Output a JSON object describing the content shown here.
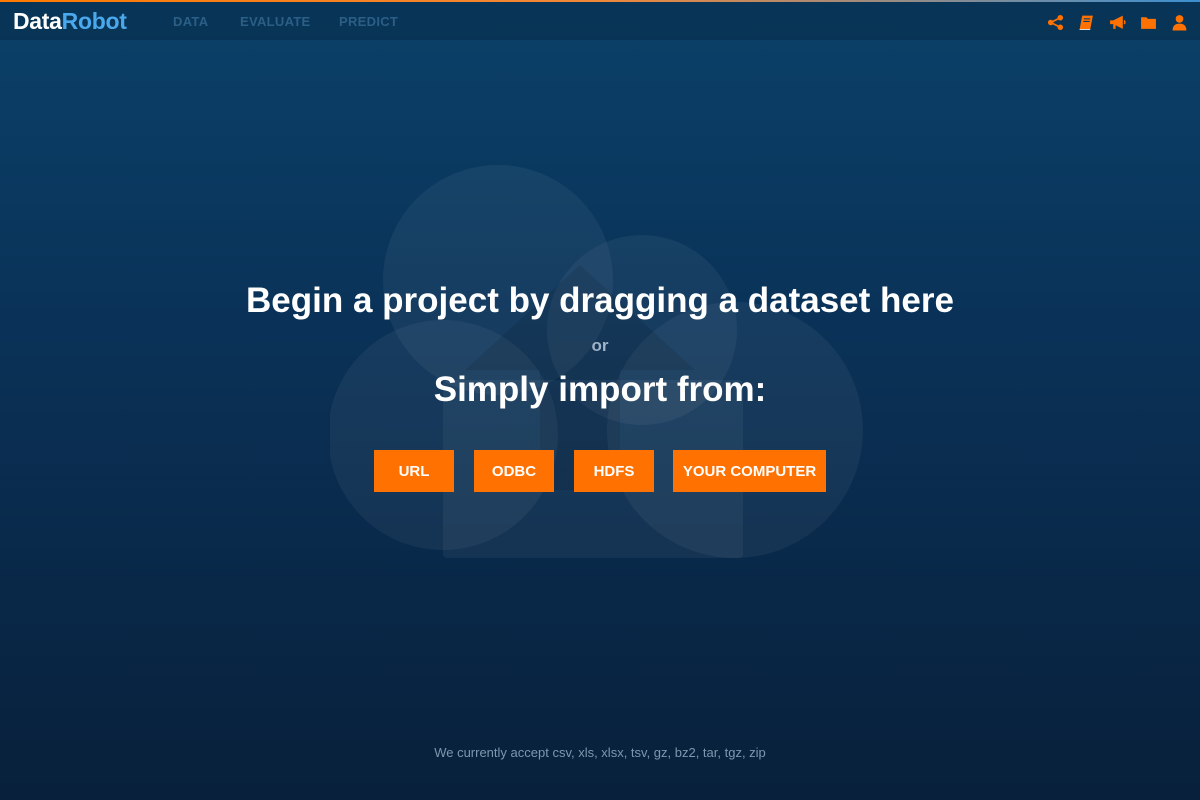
{
  "brand": {
    "logo_part1": "Data",
    "logo_part2": "Robot",
    "colors": {
      "accent": "#ff7100",
      "logo_blue": "#4aa8ec"
    }
  },
  "nav": {
    "tabs": [
      {
        "label": "DATA"
      },
      {
        "label": "EVALUATE"
      },
      {
        "label": "PREDICT"
      }
    ],
    "icons": [
      "share-icon",
      "book-icon",
      "megaphone-icon",
      "folder-icon",
      "user-icon"
    ]
  },
  "main": {
    "headline": "Begin a project by dragging a dataset here",
    "or_text": "or",
    "subhead": "Simply import from:",
    "buttons": {
      "url": "URL",
      "odbc": "ODBC",
      "hdfs": "HDFS",
      "computer": "YOUR COMPUTER"
    },
    "background_icon": "cloud-upload-icon"
  },
  "footer": {
    "accepted_formats": "We currently accept csv, xls, xlsx, tsv, gz, bz2, tar, tgz, zip"
  }
}
